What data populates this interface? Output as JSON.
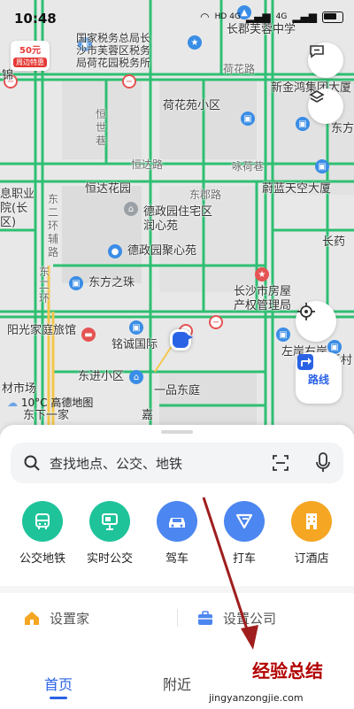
{
  "status_bar": {
    "time": "10:48",
    "network": "HD 4G",
    "signal": "4G"
  },
  "colors": {
    "road": "#2ebf72",
    "accent": "#2a62e6",
    "poi_blue": "#3a8de6",
    "poi_red": "#e55353"
  },
  "promo_badge": {
    "amount": "50元",
    "text": "周边特惠"
  },
  "map": {
    "labels": {
      "tax_bureau": "国家税务总局长沙市芙蓉区税务局荷花园税务所",
      "changjun_school": "长郡芙蓉中学",
      "hehua_road": "荷花路",
      "xinjinhong": "新金鸿集团大厦",
      "hehuayuan_district": "荷花苑小区",
      "dong": "东方",
      "hengshi": "恒\n世\n巷",
      "hengda_road": "恒达路",
      "yonghe_lane": "咏荷巷",
      "weilan": "蔚蓝天空大厦",
      "vocational": "息职业\n院(长\n区)",
      "dongerhuan": "东\n二\n环\n辅\n路",
      "hengda_garden": "恒达花园",
      "dongjun_road": "东郡路",
      "deyuan_garden": "德政园住宅区润心苑",
      "changyao": "长药",
      "deyuan_kindergarten": "德政园聚心苑",
      "dongfang_pearl": "东方之珠",
      "property_center": "长沙市房屋产权管理局",
      "dongerhuan2": "东\n二\n环",
      "yangguang_hotel": "阳光家庭旅馆",
      "mingcheng": "铭诚国际",
      "zuoan": "左岸右岸",
      "xincun": "新村",
      "dongjin": "东进小区",
      "yipin": "一品东庭",
      "market": "材市场",
      "dongxia": "东下一家",
      "amap": "高德地图",
      "jiang": "嘉",
      "jin": "锦"
    },
    "weather": "10°C",
    "route_button": "路线"
  },
  "search": {
    "placeholder": "查找地点、公交、地铁"
  },
  "quick_actions": [
    {
      "label": "公交地铁",
      "icon": "bus-icon",
      "color": "#1fc39a"
    },
    {
      "label": "实时公交",
      "icon": "bus-stop-icon",
      "color": "#1fc39a"
    },
    {
      "label": "驾车",
      "icon": "car-icon",
      "color": "#4c86f0"
    },
    {
      "label": "打车",
      "icon": "taxi-icon",
      "color": "#4c86f0"
    },
    {
      "label": "订酒店",
      "icon": "hotel-icon",
      "color": "#f5a623"
    }
  ],
  "places": {
    "home": "设置家",
    "company": "设置公司"
  },
  "tabs": [
    {
      "label": "首页"
    },
    {
      "label": "附近"
    }
  ],
  "watermark": {
    "title": "经验总结",
    "url": "jingyanzongjie.com"
  }
}
